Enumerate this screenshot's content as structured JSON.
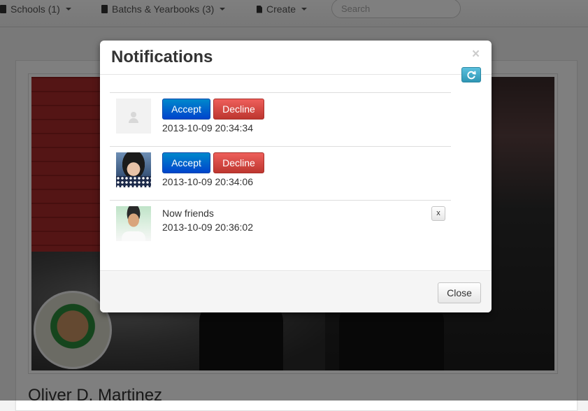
{
  "navbar": {
    "items": [
      {
        "label": "Schools (1)",
        "icon": "book-icon"
      },
      {
        "label": "Batchs & Yearbooks (3)",
        "icon": "book-icon"
      },
      {
        "label": "Create",
        "icon": "file-icon"
      }
    ],
    "search_placeholder": "Search"
  },
  "profile": {
    "name": "Oliver D. Martinez"
  },
  "modal": {
    "title": "Notifications",
    "close_glyph": "×",
    "refresh_icon": "refresh-icon",
    "accent_color": "#0044cc",
    "danger_color": "#bd362f",
    "notifications": [
      {
        "type": "request",
        "avatar": "default-avatar",
        "accept_label": "Accept",
        "decline_label": "Decline",
        "time": "2013-10-09 20:34:34"
      },
      {
        "type": "request",
        "avatar": "girl-avatar",
        "accept_label": "Accept",
        "decline_label": "Decline",
        "time": "2013-10-09 20:34:06"
      },
      {
        "type": "info",
        "avatar": "boy-avatar",
        "text": "Now friends",
        "time": "2013-10-09 20:36:02",
        "dismiss_label": "x"
      }
    ],
    "footer": {
      "close_label": "Close"
    }
  }
}
